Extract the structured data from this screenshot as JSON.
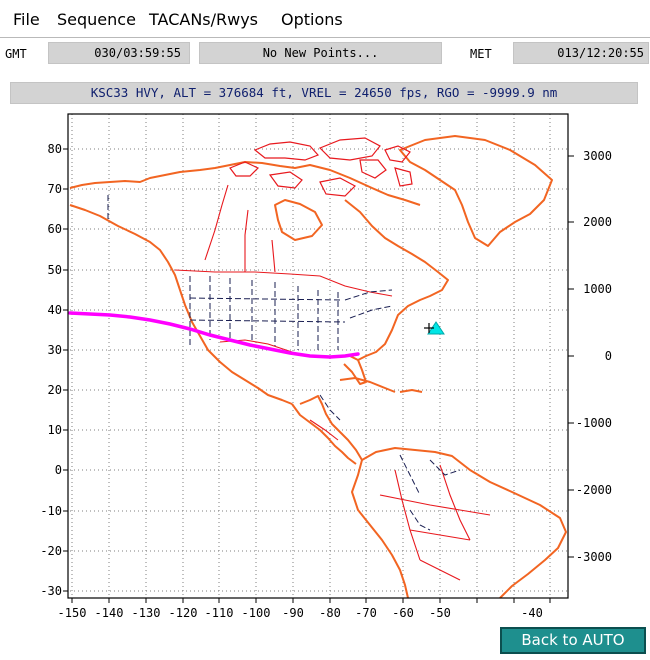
{
  "menu": {
    "file": "File",
    "sequence": "Sequence",
    "tacans": "TACANs/Rwys",
    "options": "Options"
  },
  "times": {
    "gmt_label": "GMT",
    "gmt_value": "030/03:59:55",
    "points_status": "No New Points...",
    "met_label": "MET",
    "met_value": "013/12:20:55"
  },
  "status_line": "KSC33 HVY, ALT = 376684 ft, VREL = 24650 fps, RGO = -9999.9 nm",
  "back_button": "Back to AUTO",
  "map": {
    "x_ticks": [
      "-150",
      "-140",
      "-130",
      "-120",
      "-110",
      "-100",
      "-90",
      "-80",
      "-70",
      "-60",
      "-50",
      "-40"
    ],
    "y_left_ticks": [
      "80",
      "70",
      "60",
      "50",
      "40",
      "30",
      "20",
      "10",
      "0",
      "-10",
      "-20",
      "-30"
    ],
    "y_right_ticks": [
      "3000",
      "2000",
      "1000",
      "0",
      "-1000",
      "-2000",
      "-3000"
    ],
    "colors": {
      "coast": "#f26522",
      "borders": "#e8191e",
      "states": "#1a1f52",
      "trajectory": "#ff00ff",
      "target": "#00e5e5",
      "grid": "#7f7f7f"
    }
  }
}
